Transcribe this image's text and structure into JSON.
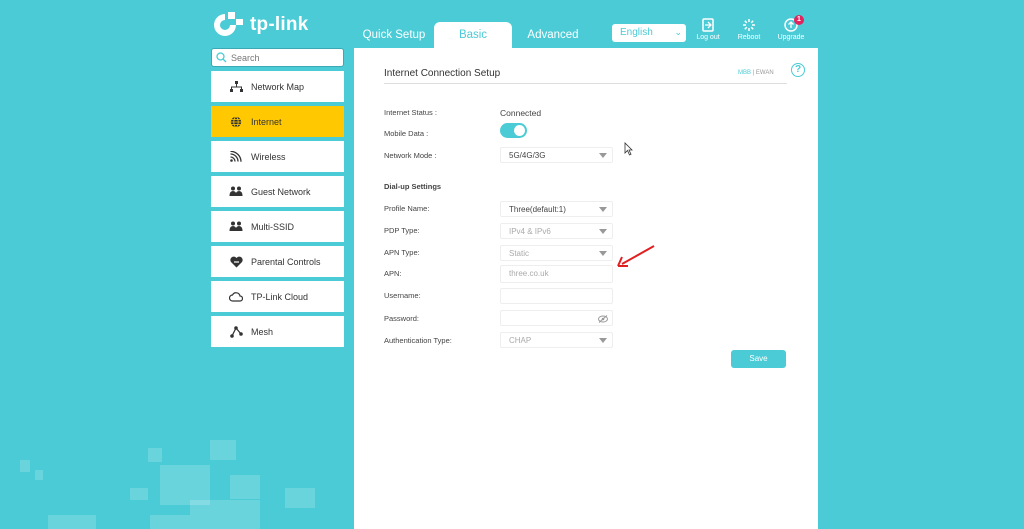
{
  "brand": {
    "logo_text": "tp-link"
  },
  "tabs": [
    {
      "label": "Quick Setup",
      "active": false
    },
    {
      "label": "Basic",
      "active": true
    },
    {
      "label": "Advanced",
      "active": false
    }
  ],
  "language": {
    "selected": "English"
  },
  "header_buttons": {
    "logout": "Log out",
    "reboot": "Reboot",
    "upgrade": "Upgrade",
    "upgrade_badge": "1"
  },
  "sidebar": {
    "search_placeholder": "Search",
    "items": [
      {
        "label": "Network Map",
        "icon": "network-map-icon"
      },
      {
        "label": "Internet",
        "icon": "globe-icon",
        "active": true
      },
      {
        "label": "Wireless",
        "icon": "wifi-icon"
      },
      {
        "label": "Guest Network",
        "icon": "guest-network-icon"
      },
      {
        "label": "Multi-SSID",
        "icon": "multi-ssid-icon"
      },
      {
        "label": "Parental Controls",
        "icon": "parental-controls-icon"
      },
      {
        "label": "TP-Link Cloud",
        "icon": "cloud-icon"
      },
      {
        "label": "Mesh",
        "icon": "mesh-icon"
      }
    ]
  },
  "main": {
    "title": "Internet Connection Setup",
    "mode_mbb": "MBB",
    "mode_sep": "|",
    "mode_ewan": "EWAN",
    "internet_status_label": "Internet Status :",
    "internet_status_value": "Connected",
    "mobile_data_label": "Mobile Data :",
    "network_mode_label": "Network Mode :",
    "network_mode_value": "5G/4G/3G",
    "dialup_heading": "Dial-up Settings",
    "profile_name_label": "Profile Name:",
    "profile_name_value": "Three(default:1)",
    "pdp_type_label": "PDP Type:",
    "pdp_type_value": "IPv4 & IPv6",
    "apn_type_label": "APN Type:",
    "apn_type_value": "Static",
    "apn_label": "APN:",
    "apn_value": "three.co.uk",
    "username_label": "Username:",
    "username_value": "",
    "password_label": "Password:",
    "password_value": "",
    "auth_type_label": "Authentication Type:",
    "auth_type_value": "CHAP",
    "save_label": "Save"
  },
  "colors": {
    "accent": "#4acbd6",
    "active_item": "#ffc800",
    "annotation": "#e02020"
  }
}
